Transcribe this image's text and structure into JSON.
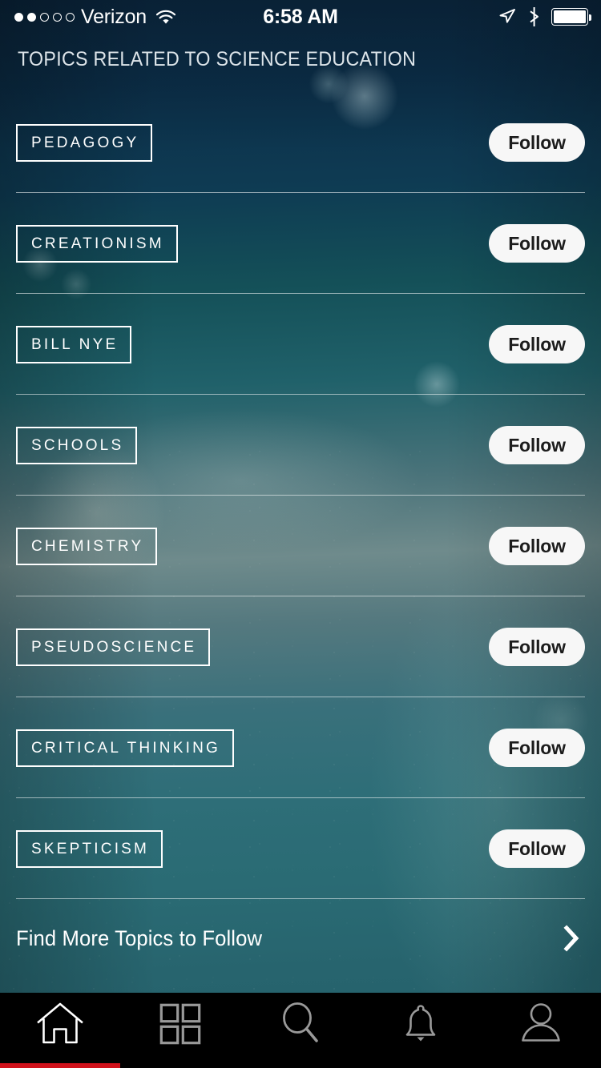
{
  "status_bar": {
    "signal_dots_filled": 2,
    "signal_dots_total": 5,
    "carrier": "Verizon",
    "wifi_icon": "wifi-icon",
    "time": "6:58 AM",
    "location_icon": "location-arrow-icon",
    "bluetooth_icon": "bluetooth-icon",
    "battery_icon": "battery-full-icon",
    "battery_level_percent": 100
  },
  "header": {
    "title": "TOPICS RELATED TO SCIENCE EDUCATION"
  },
  "topics": [
    {
      "name": "PEDAGOGY",
      "action_label": "Follow"
    },
    {
      "name": "CREATIONISM",
      "action_label": "Follow"
    },
    {
      "name": "BILL NYE",
      "action_label": "Follow"
    },
    {
      "name": "SCHOOLS",
      "action_label": "Follow"
    },
    {
      "name": "CHEMISTRY",
      "action_label": "Follow"
    },
    {
      "name": "PSEUDOSCIENCE",
      "action_label": "Follow"
    },
    {
      "name": "CRITICAL THINKING",
      "action_label": "Follow"
    },
    {
      "name": "SKEPTICISM",
      "action_label": "Follow"
    }
  ],
  "find_more": {
    "label": "Find More Topics to Follow",
    "chevron_icon": "chevron-right-icon"
  },
  "tab_bar": {
    "items": [
      {
        "icon": "home-icon",
        "active": true
      },
      {
        "icon": "grid-icon",
        "active": false
      },
      {
        "icon": "search-icon",
        "active": false
      },
      {
        "icon": "bell-icon",
        "active": false
      },
      {
        "icon": "person-icon",
        "active": false
      }
    ],
    "indicator_color": "#d0111b",
    "active_color": "#ffffff",
    "inactive_color": "#999999",
    "background_color": "#000000"
  },
  "theme": {
    "tag_border_color": "#ffffff",
    "tag_text_color": "#ffffff",
    "follow_button_bg": "#f7f7f7",
    "follow_button_text": "#1c1c1c",
    "separator_color": "rgba(255,255,255,0.55)"
  }
}
